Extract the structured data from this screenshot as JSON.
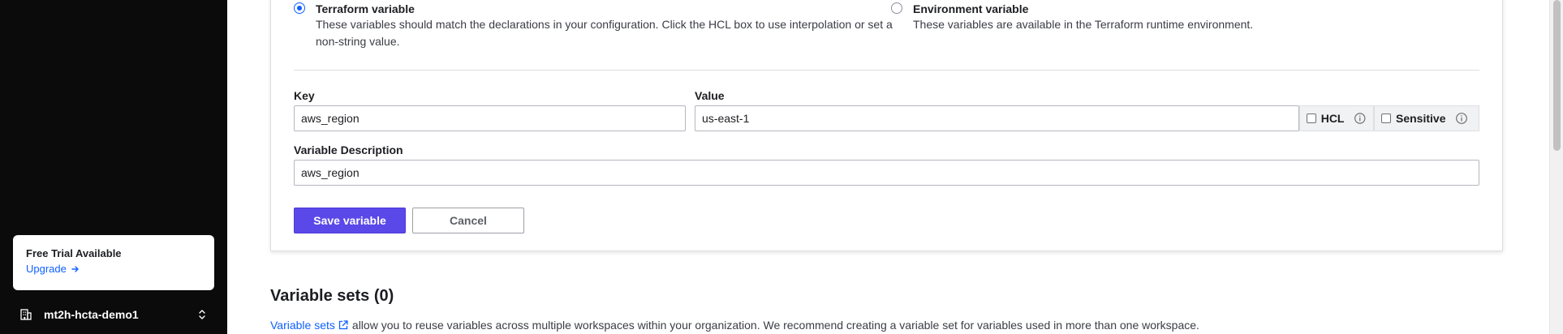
{
  "sidebar": {
    "trial_card": {
      "title": "Free Trial Available",
      "link_label": "Upgrade"
    },
    "org": {
      "name": "mt2h-hcta-demo1"
    }
  },
  "variable_form": {
    "category": {
      "terraform": {
        "label": "Terraform variable",
        "description": "These variables should match the declarations in your configuration. Click the HCL box to use interpolation or set a non-string value.",
        "selected": true
      },
      "environment": {
        "label": "Environment variable",
        "description": "These variables are available in the Terraform runtime environment.",
        "selected": false
      }
    },
    "key": {
      "label": "Key",
      "value": "aws_region"
    },
    "value": {
      "label": "Value",
      "value": "us-east-1"
    },
    "hcl": {
      "label": "HCL",
      "checked": false
    },
    "sensitive": {
      "label": "Sensitive",
      "checked": false
    },
    "description": {
      "label": "Variable Description",
      "value": "aws_region"
    },
    "save_label": "Save variable",
    "cancel_label": "Cancel"
  },
  "variable_sets": {
    "title": "Variable sets (0)",
    "link_text": "Variable sets",
    "description": "allow you to reuse variables across multiple workspaces within your organization. We recommend creating a variable set for variables used in more than one workspace."
  },
  "colors": {
    "primary_button": "#5b48e8",
    "link": "#1060ff",
    "sidebar": "#0b0b0c"
  }
}
